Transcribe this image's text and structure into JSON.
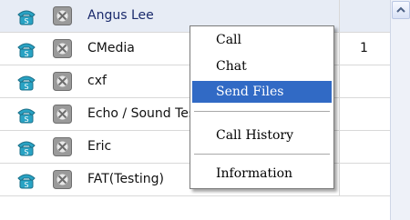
{
  "contacts": [
    {
      "name": "Angus Lee",
      "count": ""
    },
    {
      "name": "CMedia",
      "count": "1"
    },
    {
      "name": "cxf",
      "count": ""
    },
    {
      "name": "Echo / Sound Test Service",
      "count": ""
    },
    {
      "name": "Eric",
      "count": ""
    },
    {
      "name": "FAT(Testing)",
      "count": ""
    }
  ],
  "context_menu": {
    "items": [
      {
        "label": "Call"
      },
      {
        "label": "Chat"
      },
      {
        "label": "Send Files"
      },
      {
        "label": "Call History"
      },
      {
        "label": "Information"
      }
    ],
    "highlighted_item": "Send Files"
  },
  "colors": {
    "highlight": "#316ac5",
    "selected_row": "#e7ecf5",
    "phone_icon": "#29a3c4",
    "block_icon": "#8a8a8a"
  }
}
